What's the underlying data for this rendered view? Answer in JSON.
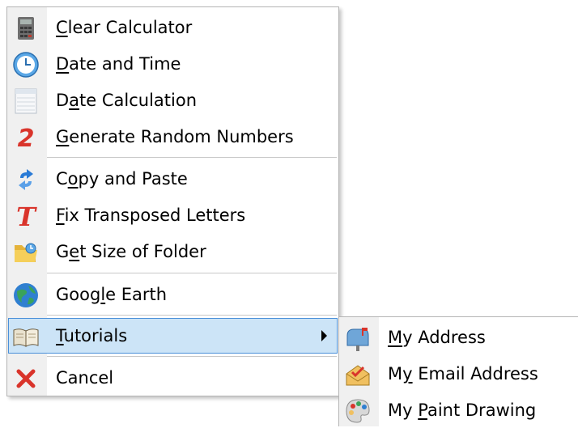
{
  "main_menu": {
    "items": [
      {
        "pre": "",
        "acc": "C",
        "post": "lear Calculator",
        "icon": "calculator-icon"
      },
      {
        "pre": "",
        "acc": "D",
        "post": "ate and Time",
        "icon": "clock-icon"
      },
      {
        "pre": "D",
        "acc": "a",
        "post": "te Calculation",
        "icon": "calendar-icon"
      },
      {
        "pre": "",
        "acc": "G",
        "post": "enerate Random Numbers",
        "icon": "number-two-icon"
      },
      {
        "pre": "C",
        "acc": "o",
        "post": "py and Paste",
        "icon": "copy-paste-arrows-icon"
      },
      {
        "pre": "",
        "acc": "F",
        "post": "ix Transposed Letters",
        "icon": "letter-t-icon"
      },
      {
        "pre": "G",
        "acc": "e",
        "post": "t Size of Folder",
        "icon": "folder-icon"
      },
      {
        "pre": "Goog",
        "acc": "l",
        "post": "e Earth",
        "icon": "globe-icon"
      },
      {
        "pre": "",
        "acc": "T",
        "post": "utorials",
        "icon": "book-icon"
      },
      {
        "pre": "Cancel",
        "acc": "",
        "post": "",
        "icon": "close-icon"
      }
    ]
  },
  "sub_menu": {
    "items": [
      {
        "pre": "",
        "acc": "M",
        "post": "y Address",
        "icon": "mailbox-icon"
      },
      {
        "pre": "M",
        "acc": "y",
        "post": " Email Address",
        "icon": "email-icon"
      },
      {
        "pre": "My ",
        "acc": "P",
        "post": "aint Drawing",
        "icon": "paint-palette-icon"
      }
    ]
  },
  "colors": {
    "selected_bg": "#cce4f7",
    "selected_border": "#4a90d9",
    "red": "#d9342b",
    "blue": "#2a7bd6"
  }
}
